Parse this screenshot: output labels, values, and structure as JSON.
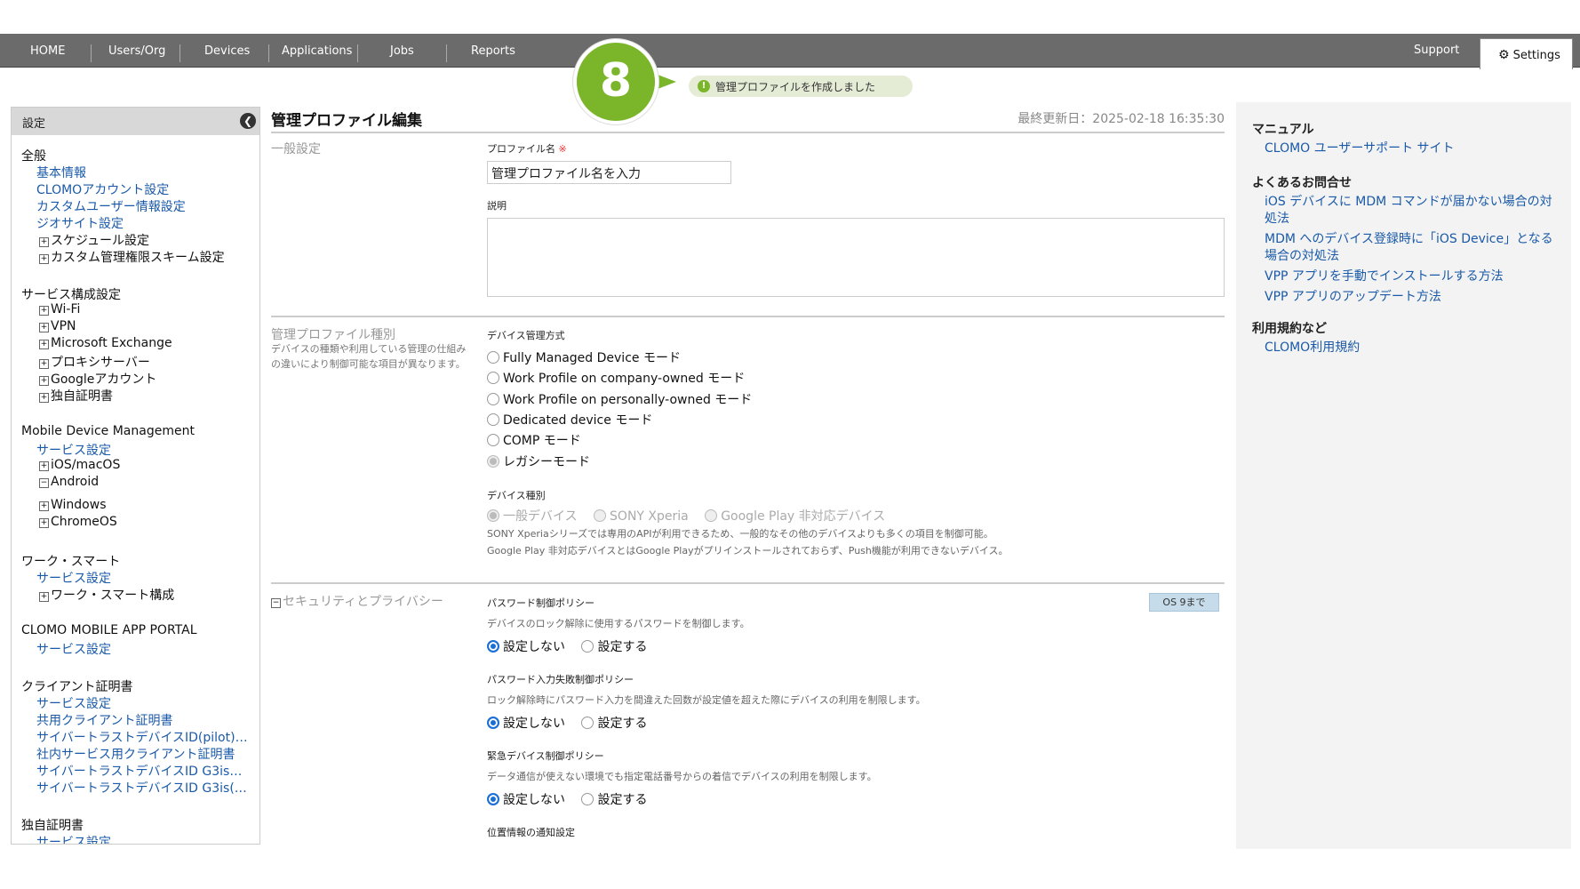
{
  "nav": {
    "items": [
      "HOME",
      "Users/Org",
      "Devices",
      "Applications",
      "Jobs",
      "Reports"
    ],
    "support": "Support",
    "settings": "Settings"
  },
  "step_badge": "8",
  "toast": "管理プロファイルを作成しました",
  "sidebar": {
    "header": "設定",
    "groups": [
      {
        "title": "全般",
        "items": [
          {
            "label": "基本情報",
            "type": "link"
          },
          {
            "label": "CLOMOアカウント設定",
            "type": "link"
          },
          {
            "label": "カスタムユーザー情報設定",
            "type": "link"
          },
          {
            "label": "ジオサイト設定",
            "type": "link"
          },
          {
            "label": "スケジュール設定",
            "type": "expand"
          },
          {
            "label": "カスタム管理権限スキーム設定",
            "type": "expand"
          }
        ]
      },
      {
        "title": "サービス構成設定",
        "items": [
          {
            "label": "Wi-Fi",
            "type": "expand"
          },
          {
            "label": "VPN",
            "type": "expand"
          },
          {
            "label": "Microsoft Exchange",
            "type": "expand"
          },
          {
            "label": "プロキシサーバー",
            "type": "expand"
          },
          {
            "label": "Googleアカウント",
            "type": "expand"
          },
          {
            "label": "独自証明書",
            "type": "expand"
          }
        ]
      },
      {
        "title": "Mobile Device Management",
        "items": [
          {
            "label": "サービス設定",
            "type": "link"
          },
          {
            "label": "iOS/macOS",
            "type": "expand"
          },
          {
            "label": "Android",
            "type": "collapse"
          },
          {
            "label": "Windows",
            "type": "expand"
          },
          {
            "label": "ChromeOS",
            "type": "expand"
          }
        ]
      },
      {
        "title": "ワーク・スマート",
        "items": [
          {
            "label": "サービス設定",
            "type": "link"
          },
          {
            "label": "ワーク・スマート構成",
            "type": "expand"
          }
        ]
      },
      {
        "title": "CLOMO MOBILE APP PORTAL",
        "items": [
          {
            "label": "サービス設定",
            "type": "link"
          }
        ]
      },
      {
        "title": "クライアント証明書",
        "items": [
          {
            "label": "サービス設定",
            "type": "link"
          },
          {
            "label": "共用クライアント証明書",
            "type": "link"
          },
          {
            "label": "サイバートラストデバイスID(pilot)…",
            "type": "link"
          },
          {
            "label": "社内サービス用クライアント証明書",
            "type": "link"
          },
          {
            "label": "サイバートラストデバイスID G3is…",
            "type": "link"
          },
          {
            "label": "サイバートラストデバイスID G3is(…",
            "type": "link"
          }
        ]
      },
      {
        "title": "独自証明書",
        "items": [
          {
            "label": "サービス設定",
            "type": "link"
          }
        ]
      }
    ]
  },
  "main": {
    "title": "管理プロファイル編集",
    "last_updated": "最終更新日：2025-02-18 16:35:30",
    "general": {
      "label": "一般設定",
      "profile_name_label": "プロファイル名",
      "required_mark": "※",
      "profile_name_value": "管理プロファイル名を入力",
      "description_label": "説明"
    },
    "profile_type": {
      "label": "管理プロファイル種別",
      "desc": "デバイスの種類や利用している管理の仕組みの違いにより制御可能な項目が異なります。",
      "mgmt_label": "デバイス管理方式",
      "mgmt_options": [
        "Fully Managed Device モード",
        "Work Profile on company-owned モード",
        "Work Profile on personally-owned モード",
        "Dedicated device モード",
        "COMP モード",
        "レガシーモード"
      ],
      "device_type_label": "デバイス種別",
      "device_types": [
        "一般デバイス",
        "SONY Xperia",
        "Google Play 非対応デバイス"
      ],
      "note1": "SONY Xperiaシリーズでは専用のAPIが利用できるため、一般的なその他のデバイスよりも多くの項目を制御可能。",
      "note2": "Google Play 非対応デバイスとはGoogle Playがプリインストールされておらず、Push機能が利用できないデバイス。"
    },
    "security": {
      "label": "セキュリティとプライバシー",
      "os_tag": "OS 9まで",
      "not_set": "設定しない",
      "set": "設定する",
      "policies": [
        {
          "title": "パスワード制御ポリシー",
          "desc": "デバイスのロック解除に使用するパスワードを制御します。"
        },
        {
          "title": "パスワード入力失敗制御ポリシー",
          "desc": "ロック解除時にパスワード入力を間違えた回数が設定値を超えた際にデバイスの利用を制限します。"
        },
        {
          "title": "緊急デバイス制御ポリシー",
          "desc": "データ通信が使えない環境でも指定電話番号からの着信でデバイスの利用を制限します。"
        }
      ],
      "location_title": "位置情報の通知設定"
    }
  },
  "right": {
    "manual_title": "マニュアル",
    "manual_link": "CLOMO ユーザーサポート サイト",
    "faq_title": "よくあるお問合せ",
    "faq_links": [
      "iOS デバイスに MDM コマンドが届かない場合の対処法",
      "MDM へのデバイス登録時に「iOS Device」となる場合の対処法",
      "VPP アプリを手動でインストールする方法",
      "VPP アプリのアップデート方法"
    ],
    "terms_title": "利用規約など",
    "terms_link": "CLOMO利用規約"
  }
}
